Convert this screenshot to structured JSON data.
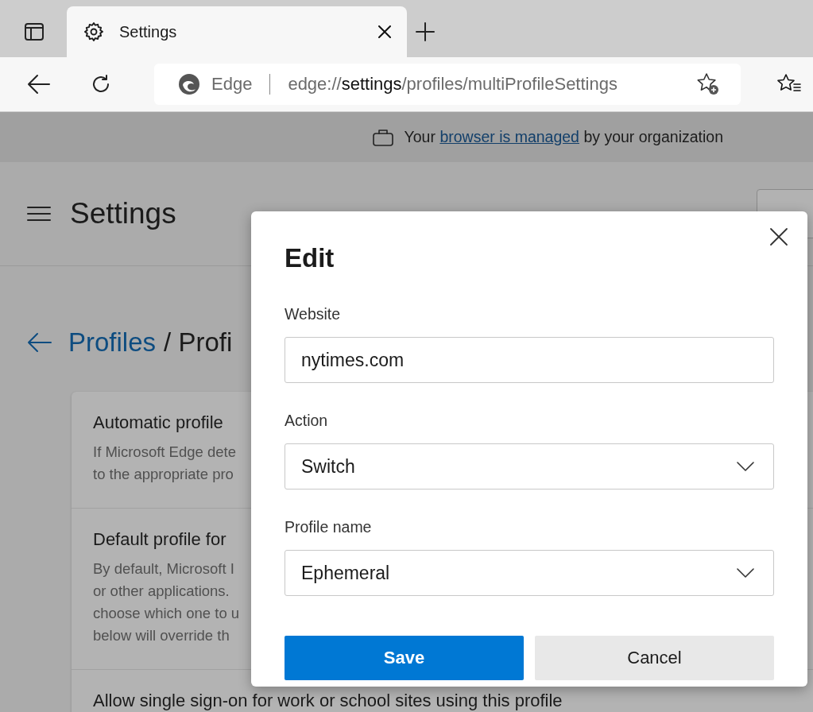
{
  "browser": {
    "tabs": [
      {
        "title": "Settings",
        "selected": true
      }
    ],
    "address_bar": {
      "site_label": "Edge",
      "url_scheme": "edge://",
      "url_host": "settings",
      "url_path": "/profiles/multiProfileSettings"
    }
  },
  "managed_banner": {
    "before": "Your",
    "link": "browser is managed",
    "after": "by your organization"
  },
  "page": {
    "title": "Settings",
    "breadcrumb": {
      "parent": "Profiles",
      "current": "/ Profi"
    },
    "settings": [
      {
        "title": "Automatic profile",
        "description_lines": [
          "If Microsoft Edge dete",
          "to the appropriate pro"
        ]
      },
      {
        "title": "Default profile for",
        "description_lines": [
          "By default, Microsoft I",
          "or other applications.",
          "choose which one to u",
          "below will override th"
        ]
      },
      {
        "title": "Allow single sign-on for work or school sites using this profile"
      }
    ]
  },
  "dialog": {
    "title": "Edit",
    "fields": [
      {
        "kind": "text",
        "label": "Website",
        "value": "nytimes.com"
      },
      {
        "kind": "select",
        "label": "Action",
        "value": "Switch"
      },
      {
        "kind": "select",
        "label": "Profile name",
        "value": "Ephemeral"
      }
    ],
    "buttons": [
      {
        "kind": "primary",
        "label": "Save"
      },
      {
        "kind": "secondary",
        "label": "Cancel"
      }
    ]
  }
}
